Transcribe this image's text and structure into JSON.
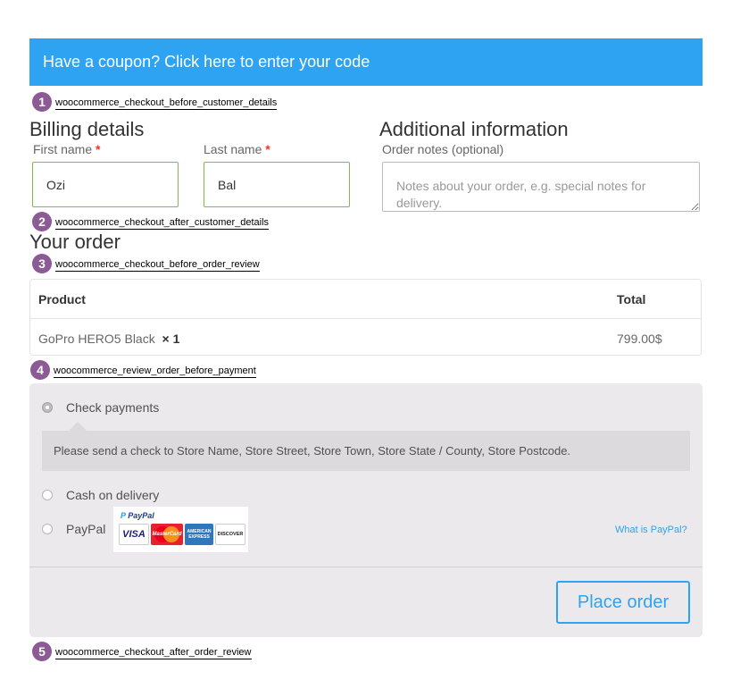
{
  "coupon": {
    "text": "Have a coupon? Click here to enter your code"
  },
  "hooks": [
    {
      "num": "1",
      "name": "woocommerce_checkout_before_customer_details"
    },
    {
      "num": "2",
      "name": "woocommerce_checkout_after_customer_details"
    },
    {
      "num": "3",
      "name": "woocommerce_checkout_before_order_review"
    },
    {
      "num": "4",
      "name": "woocommerce_review_order_before_payment"
    },
    {
      "num": "5",
      "name": "woocommerce_checkout_after_order_review"
    }
  ],
  "billing": {
    "title": "Billing details",
    "first_name_label": "First name",
    "first_name_value": "Ozi",
    "last_name_label": "Last name",
    "last_name_value": "Bal",
    "required_mark": "*"
  },
  "additional": {
    "title": "Additional information",
    "notes_label": "Order notes (optional)",
    "notes_placeholder": "Notes about your order, e.g. special notes for delivery."
  },
  "order": {
    "title": "Your order",
    "columns": [
      "Product",
      "Total"
    ],
    "rows": [
      {
        "product": "GoPro HERO5 Black",
        "qty": "× 1",
        "total": "799.00$"
      }
    ]
  },
  "payment": {
    "methods": [
      {
        "label": "Check payments",
        "checked": true
      },
      {
        "label": "Cash on delivery",
        "checked": false
      },
      {
        "label": "PayPal",
        "checked": false
      }
    ],
    "check_description": "Please send a check to Store Name, Store Street, Store Town, Store State / County, Store Postcode.",
    "paypal_logo_text": "PayPal",
    "paypal_cards": [
      "VISA",
      "MasterCard",
      "AMERICAN EXPRESS",
      "DISCOVER"
    ],
    "what_is_paypal": "What is PayPal?",
    "place_order": "Place order"
  },
  "colors": {
    "accent": "#2ea3f2",
    "valid_border": "#7fba4a",
    "hook_badge": "#8c5a95",
    "panel": "#ebe9eb"
  }
}
